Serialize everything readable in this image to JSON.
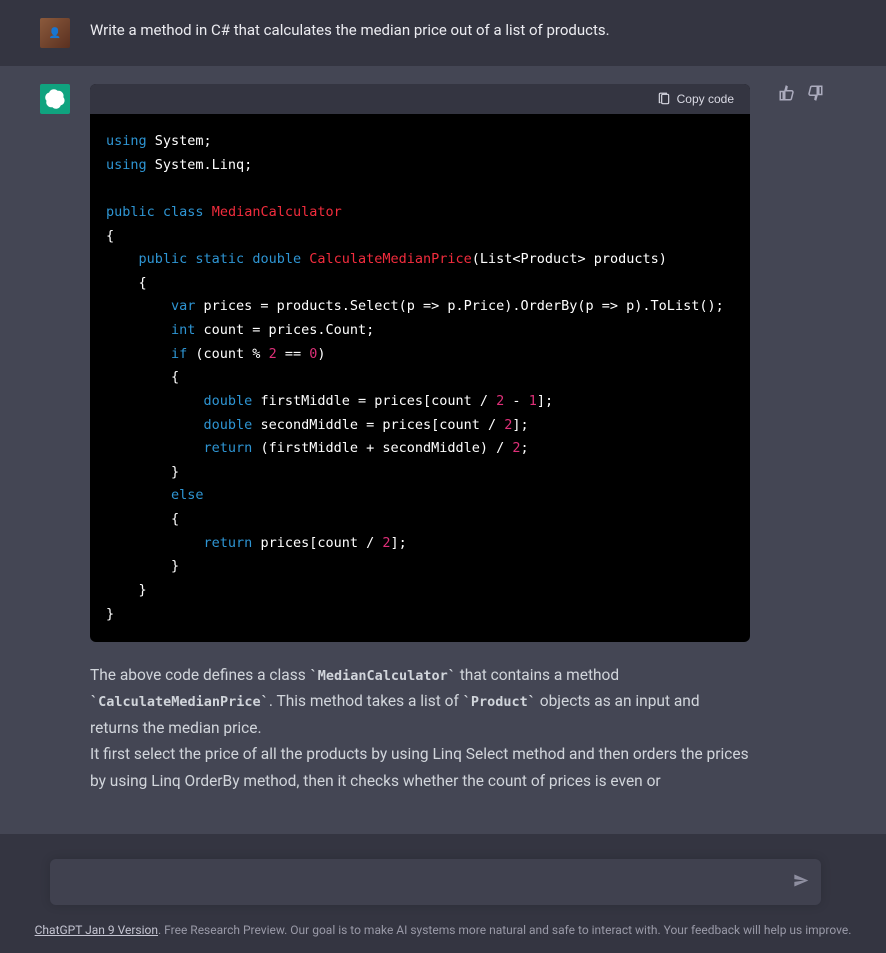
{
  "user_message": "Write a method in C# that calculates the median price out of a list of products.",
  "copy_label": "Copy code",
  "code": {
    "l1a": "using",
    "l1b": " System;",
    "l2a": "using",
    "l2b": " System.Linq;",
    "l4a": "public",
    "l4b": " class",
    "l4c": " MedianCalculator",
    "l5": "{",
    "l6a": "    public",
    "l6b": " static",
    "l6c": " double",
    "l6d": " CalculateMedianPrice",
    "l6e": "(List<Product> products)",
    "l7": "    {",
    "l8a": "        var",
    "l8b": " prices = products.Select(p => p.Price).OrderBy(p => p).ToList();",
    "l9a": "        int",
    "l9b": " count = prices.Count;",
    "l10a": "        if",
    "l10b": " (count % ",
    "l10c": "2",
    "l10d": " == ",
    "l10e": "0",
    "l10f": ")",
    "l11": "        {",
    "l12a": "            double",
    "l12b": " firstMiddle = prices[count / ",
    "l12c": "2",
    "l12d": " - ",
    "l12e": "1",
    "l12f": "];",
    "l13a": "            double",
    "l13b": " secondMiddle = prices[count / ",
    "l13c": "2",
    "l13d": "];",
    "l14a": "            return",
    "l14b": " (firstMiddle + secondMiddle) / ",
    "l14c": "2",
    "l14d": ";",
    "l15": "        }",
    "l16a": "        else",
    "l17": "        {",
    "l18a": "            return",
    "l18b": " prices[count / ",
    "l18c": "2",
    "l18d": "];",
    "l19": "        }",
    "l20": "    }",
    "l21": "}"
  },
  "explain": {
    "p1a": "The above code defines a class ",
    "p1b": "`MedianCalculator`",
    "p1c": " that contains a method ",
    "p1d": "`CalculateMedianPrice`",
    "p1e": ". This method takes a list of ",
    "p1f": "`Product`",
    "p1g": " objects as an input and returns the median price.",
    "p2": "It first select the price of all the products by using Linq Select method and then orders the prices by using Linq OrderBy method, then it checks whether the count of prices is even or"
  },
  "footer": {
    "version": "ChatGPT Jan 9 Version",
    "rest": ". Free Research Preview. Our goal is to make AI systems more natural and safe to interact with. Your feedback will help us improve."
  }
}
